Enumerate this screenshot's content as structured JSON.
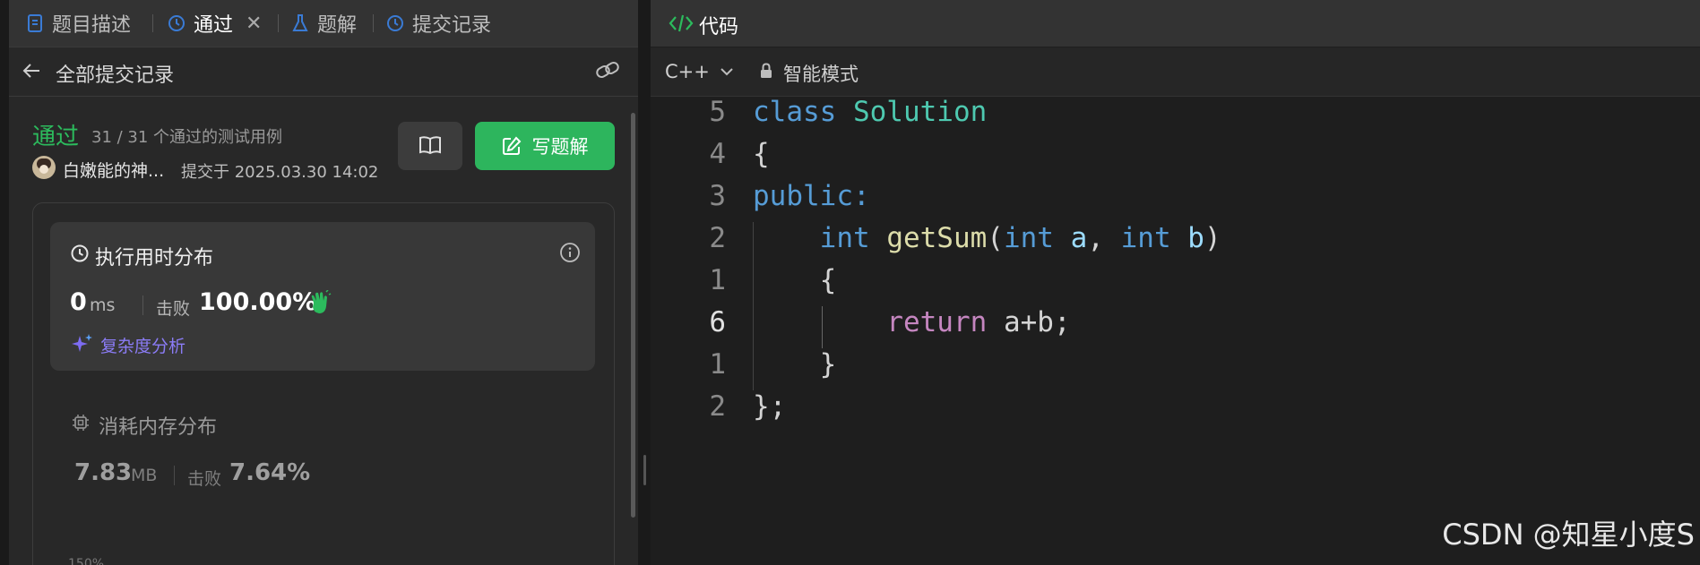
{
  "tabs": {
    "description": "题目描述",
    "passed": "通过",
    "solutions": "题解",
    "submissions": "提交记录"
  },
  "submission": {
    "back_label": "全部提交记录",
    "status": "通过",
    "testcases": "31 / 31 个通过的测试用例",
    "username": "白嫩能的神...",
    "submitted_at": "提交于 2025.03.30 14:02",
    "write_solution": "写题解"
  },
  "runtime": {
    "title": "执行用时分布",
    "value": "0",
    "unit": "ms",
    "beats_label": "击败",
    "beats": "100.00%",
    "analysis": "复杂度分析"
  },
  "memory": {
    "title": "消耗内存分布",
    "value": "7.83",
    "unit": "MB",
    "beats_label": "击败",
    "beats": "7.64%",
    "partial_tick": "150%"
  },
  "code_panel": {
    "title": "代码",
    "language": "C++",
    "mode": "智能模式"
  },
  "code": {
    "line_numbers": [
      "5",
      "4",
      "3",
      "2",
      "1",
      "6",
      "1",
      "2"
    ],
    "lines": [
      [
        {
          "t": "class ",
          "c": "kw"
        },
        {
          "t": "Solution",
          "c": "cls"
        }
      ],
      [
        {
          "t": "{",
          "c": ""
        }
      ],
      [
        {
          "t": "public:",
          "c": "kw"
        }
      ],
      [
        {
          "t": "    ",
          "c": ""
        },
        {
          "t": "int ",
          "c": "kw"
        },
        {
          "t": "getSum",
          "c": "fn"
        },
        {
          "t": "(",
          "c": ""
        },
        {
          "t": "int ",
          "c": "kw"
        },
        {
          "t": "a",
          "c": "var"
        },
        {
          "t": ", ",
          "c": ""
        },
        {
          "t": "int ",
          "c": "kw"
        },
        {
          "t": "b",
          "c": "var"
        },
        {
          "t": ")",
          "c": ""
        }
      ],
      [
        {
          "t": "    {",
          "c": ""
        }
      ],
      [
        {
          "t": "        ",
          "c": ""
        },
        {
          "t": "return ",
          "c": "ret"
        },
        {
          "t": "a+b;",
          "c": ""
        }
      ],
      [
        {
          "t": "    }",
          "c": ""
        }
      ],
      [
        {
          "t": "};",
          "c": ""
        }
      ]
    ]
  },
  "watermark": "CSDN @知星小度S",
  "colors": {
    "accent_green": "#2cbb5d",
    "button_green": "#2db55d",
    "tab_blue": "#3a7bd5",
    "analysis_purple": "#8b7cf6"
  }
}
